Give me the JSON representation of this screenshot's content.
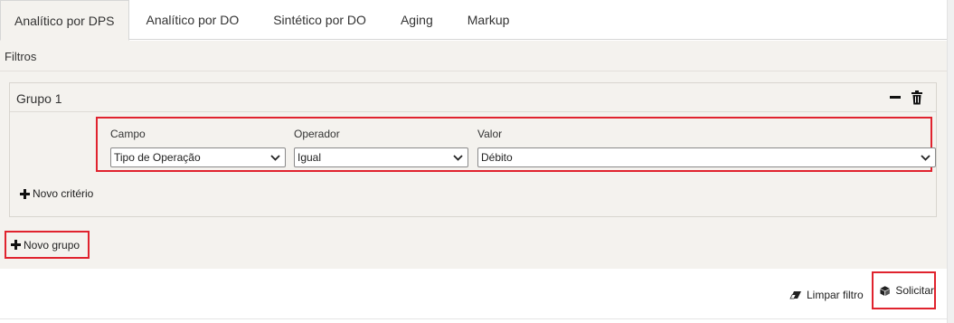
{
  "tabs": [
    {
      "label": "Analítico por DPS",
      "active": true
    },
    {
      "label": "Analítico por DO",
      "active": false
    },
    {
      "label": "Sintético por DO",
      "active": false
    },
    {
      "label": "Aging",
      "active": false
    },
    {
      "label": "Markup",
      "active": false
    }
  ],
  "filters": {
    "section_label": "Filtros",
    "group": {
      "title": "Grupo 1",
      "collapse_icon": "minus-icon",
      "delete_icon": "trash-icon",
      "criteria": {
        "campo_label": "Campo",
        "campo_value": "Tipo de Operação",
        "operador_label": "Operador",
        "operador_value": "Igual",
        "valor_label": "Valor",
        "valor_value": "Débito"
      },
      "add_criterion_label": "Novo critério"
    },
    "add_group_label": "Novo grupo"
  },
  "actions": {
    "clear_label": "Limpar filtro",
    "clear_icon": "eraser-icon",
    "submit_label": "Solicitar",
    "submit_icon": "cube-icon"
  },
  "colors": {
    "highlight": "#e0232e",
    "panel_bg": "#f4f2ee"
  }
}
